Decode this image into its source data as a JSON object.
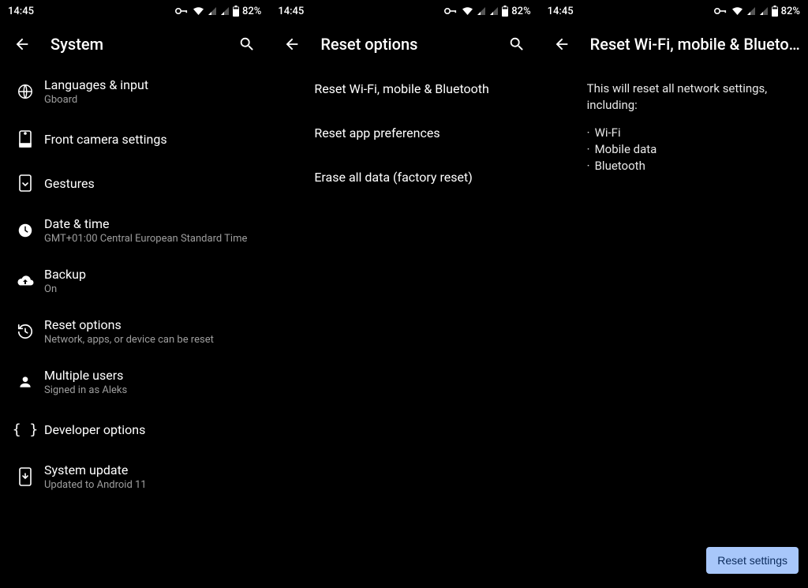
{
  "status": {
    "time": "14:45",
    "battery": "82%"
  },
  "screen1": {
    "title": "System",
    "items": [
      {
        "title": "Languages & input",
        "sub": "Gboard"
      },
      {
        "title": "Front camera settings",
        "sub": ""
      },
      {
        "title": "Gestures",
        "sub": ""
      },
      {
        "title": "Date & time",
        "sub": "GMT+01:00 Central European Standard Time"
      },
      {
        "title": "Backup",
        "sub": "On"
      },
      {
        "title": "Reset options",
        "sub": "Network, apps, or device can be reset"
      },
      {
        "title": "Multiple users",
        "sub": "Signed in as Aleks"
      },
      {
        "title": "Developer options",
        "sub": ""
      },
      {
        "title": "System update",
        "sub": "Updated to Android 11"
      }
    ]
  },
  "screen2": {
    "title": "Reset options",
    "items": [
      {
        "title": "Reset Wi-Fi, mobile & Bluetooth"
      },
      {
        "title": "Reset app preferences"
      },
      {
        "title": "Erase all data (factory reset)"
      }
    ]
  },
  "screen3": {
    "title": "Reset Wi-Fi, mobile & Blueto…",
    "description": "This will reset all network settings, including:",
    "bullets": [
      "Wi-Fi",
      "Mobile data",
      "Bluetooth"
    ],
    "button": "Reset settings"
  }
}
